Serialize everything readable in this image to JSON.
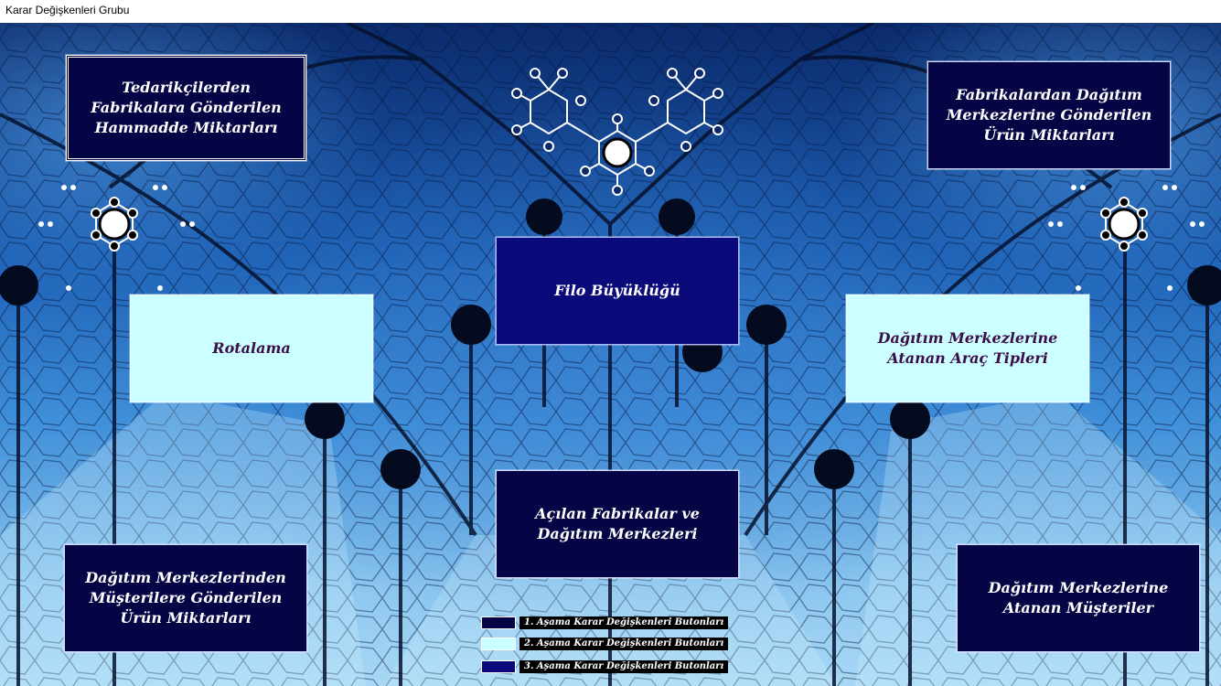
{
  "window": {
    "title": "Karar Değişkenleri Grubu"
  },
  "buttons": {
    "hammadde": "Tedarikçilerden Fabrikalara Gönderilen Hammadde Miktarları",
    "urun_dm": "Fabrikalardan Dağıtım Merkezlerine  Gönderilen Ürün Miktarları",
    "filo": "Filo Büyüklüğü",
    "rotalama": "Rotalama",
    "arac_tipleri": "Dağıtım Merkezlerine Atanan Araç Tipleri",
    "acilan": "Açılan Fabrikalar ve Dağıtım Merkezleri",
    "musteri_urun": "Dağıtım Merkezlerinden Müşterilere Gönderilen Ürün Miktarları",
    "atanan_musteriler": "Dağıtım Merkezlerine Atanan Müşteriler"
  },
  "legend": [
    {
      "label": "1. Aşama Karar Değişkenleri Butonları",
      "color": "#050545"
    },
    {
      "label": "2. Aşama Karar Değişkenleri Butonları",
      "color": "#ccffff"
    },
    {
      "label": "3. Aşama Karar Değişkenleri Butonları",
      "color": "#0a0a7a"
    }
  ],
  "background": {
    "description_icons": [
      "leaf-vein-pattern",
      "molecule-icon"
    ],
    "colors": {
      "deep": "#0b2a6b",
      "mid": "#1c5fb4",
      "light": "#a8d8f5"
    }
  }
}
